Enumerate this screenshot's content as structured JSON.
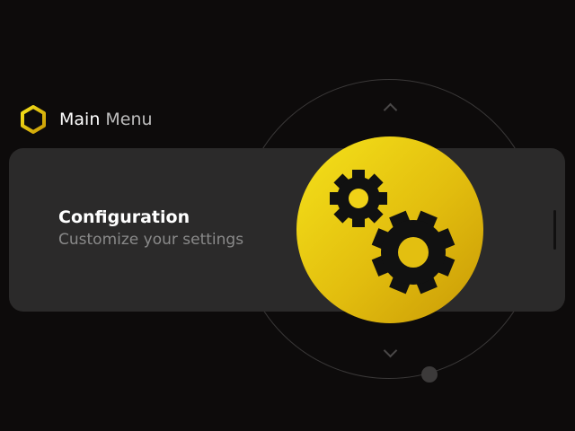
{
  "header": {
    "title_main": "Main",
    "title_sub": "Menu",
    "logo_icon": "hexagon-logo-icon"
  },
  "menu_item": {
    "title": "Configuration",
    "subtitle": "Customize your settings",
    "icon": "gears-icon"
  },
  "dial": {
    "up_icon": "chevron-up-icon",
    "down_icon": "chevron-down-icon"
  },
  "colors": {
    "background": "#0d0b0b",
    "card": "#2b2a2a",
    "accent": "#f0d217",
    "accent_dark": "#c99a06",
    "text_primary": "#ffffff",
    "text_secondary": "#8a8a8a"
  }
}
